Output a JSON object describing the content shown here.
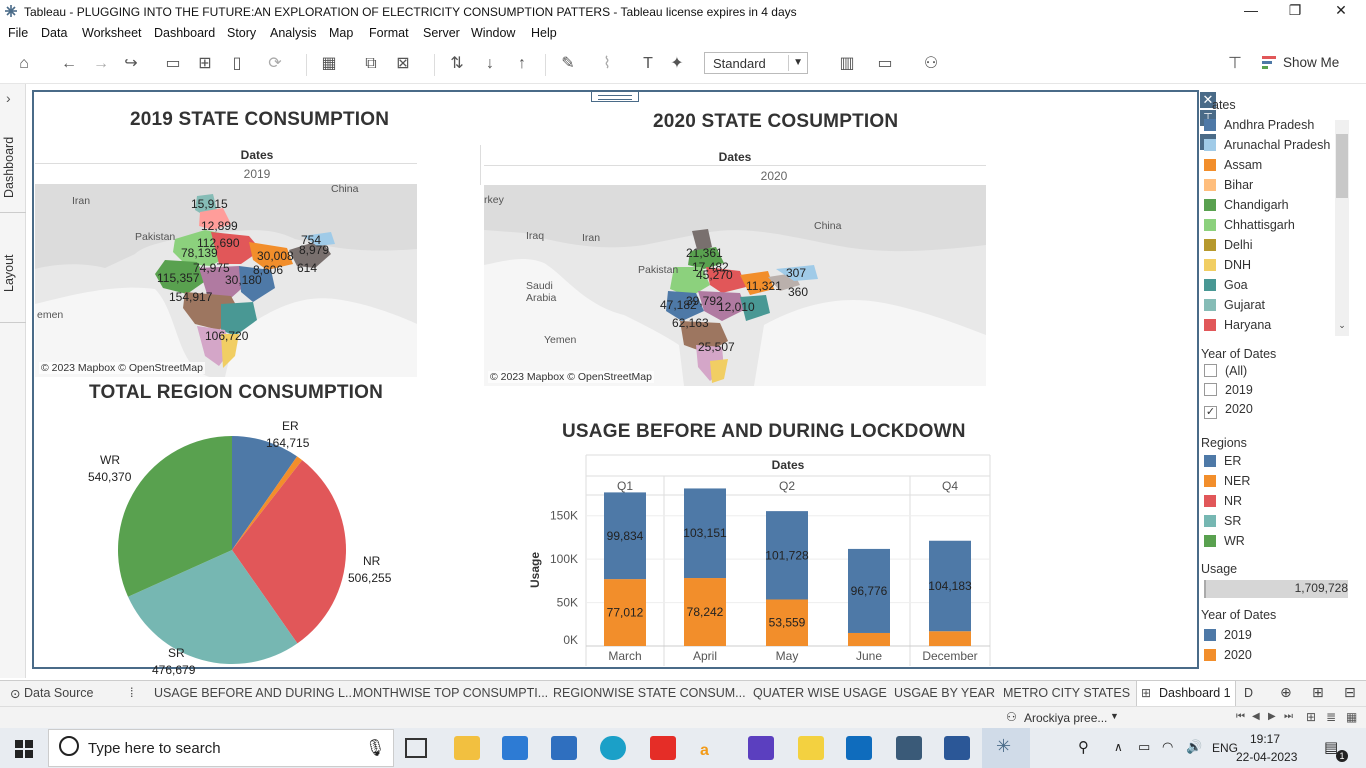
{
  "window": {
    "title": "Tableau - PLUGGING INTO THE FUTURE:AN EXPLORATION OF ELECTRICITY CONSUMPTION PATTERS - Tableau license expires in 4 days",
    "minimize": "—",
    "maximize": "❐",
    "close": "✕"
  },
  "menu": [
    "File",
    "Data",
    "Worksheet",
    "Dashboard",
    "Story",
    "Analysis",
    "Map",
    "Format",
    "Server",
    "Window",
    "Help"
  ],
  "toolbar": {
    "fit_mode": "Standard",
    "show_me": "Show Me"
  },
  "left_rail": {
    "dashboard_tab": "Dashboard",
    "layout_tab": "Layout",
    "expand": "›"
  },
  "map2019": {
    "title": "2019 STATE CONSUMPTION",
    "header": "Dates",
    "year": "2019",
    "credit": "© 2023 Mapbox © OpenStreetMap",
    "place_labels": [
      "Iran",
      "Pakistan",
      "China",
      "emen"
    ],
    "value_labels": [
      "15,915",
      "12,899",
      "112,690",
      "78,139",
      "74,975",
      "30,008",
      "754",
      "8,979",
      "8,606",
      "614",
      "115,357",
      "30,180",
      "154,917",
      "106,720"
    ]
  },
  "map2020": {
    "title": "2020 STATE COSUMPTION",
    "header": "Dates",
    "year": "2020",
    "credit": "© 2023 Mapbox © OpenStreetMap",
    "place_labels": [
      "rkey",
      "Iraq",
      "Iran",
      "Saudi",
      "Arabia",
      "Yemen",
      "Pakistan",
      "China"
    ],
    "value_labels": [
      "21,361",
      "17,482",
      "45,270",
      "11,321",
      "307",
      "360",
      "39,792",
      "47,182",
      "12,010",
      "62,163",
      "25,507"
    ]
  },
  "pie": {
    "title": "TOTAL REGION CONSUMPTION",
    "slices": [
      {
        "region": "ER",
        "value": "164,715",
        "color": "#4e79a7"
      },
      {
        "region": "NER",
        "value": "",
        "color": "#f28e2b"
      },
      {
        "region": "NR",
        "value": "506,255",
        "color": "#e15759"
      },
      {
        "region": "SR",
        "value": "476,679",
        "color": "#76b7b2"
      },
      {
        "region": "WR",
        "value": "540,370",
        "color": "#59a14f"
      }
    ]
  },
  "chart_data": {
    "type": "bar",
    "title": "USAGE BEFORE AND DURING LOCKDOWN",
    "column_header": "Dates",
    "quarters": [
      {
        "label": "Q1",
        "months": [
          "March"
        ]
      },
      {
        "label": "Q2",
        "months": [
          "April",
          "May",
          "June"
        ]
      },
      {
        "label": "Q4",
        "months": [
          "December"
        ]
      }
    ],
    "categories": [
      "March",
      "April",
      "May",
      "June",
      "December"
    ],
    "ylabel": "Usage",
    "yticks": [
      "0K",
      "50K",
      "100K",
      "150K"
    ],
    "ylim": [
      0,
      175000
    ],
    "stacked": true,
    "series": [
      {
        "name": "2020",
        "values": [
          77012,
          78242,
          53559,
          15000,
          17000
        ],
        "labels": [
          "77,012",
          "78,242",
          "53,559",
          "",
          ""
        ],
        "color": "#f28e2b"
      },
      {
        "name": "2019",
        "values": [
          99834,
          103151,
          101728,
          96776,
          104183
        ],
        "labels": [
          "99,834",
          "103,151",
          "101,728",
          "96,776",
          "104,183"
        ],
        "color": "#4e79a7"
      }
    ]
  },
  "right_panel": {
    "states_title": "ates",
    "states": [
      {
        "name": "Andhra Pradesh",
        "color": "#4e79a7"
      },
      {
        "name": "Arunachal Pradesh",
        "color": "#a0cbe8"
      },
      {
        "name": "Assam",
        "color": "#f28e2b"
      },
      {
        "name": "Bihar",
        "color": "#ffbe7d"
      },
      {
        "name": "Chandigarh",
        "color": "#59a14f"
      },
      {
        "name": "Chhattisgarh",
        "color": "#8cd17d"
      },
      {
        "name": "Delhi",
        "color": "#b6992d"
      },
      {
        "name": "DNH",
        "color": "#f1ce63"
      },
      {
        "name": "Goa",
        "color": "#499894"
      },
      {
        "name": "Gujarat",
        "color": "#86bcb6"
      },
      {
        "name": "Haryana",
        "color": "#e15759"
      }
    ],
    "year_filter_title": "Year of Dates",
    "year_filter": [
      {
        "label": "(All)",
        "checked": false
      },
      {
        "label": "2019",
        "checked": false
      },
      {
        "label": "2020",
        "checked": true
      }
    ],
    "regions_title": "Regions",
    "regions": [
      {
        "name": "ER",
        "color": "#4e79a7"
      },
      {
        "name": "NER",
        "color": "#f28e2b"
      },
      {
        "name": "NR",
        "color": "#e15759"
      },
      {
        "name": "SR",
        "color": "#76b7b2"
      },
      {
        "name": "WR",
        "color": "#59a14f"
      }
    ],
    "usage_title": "Usage",
    "usage_value": "1,709,728",
    "year_legend_title": "Year of Dates",
    "year_legend": [
      {
        "name": "2019",
        "color": "#4e79a7"
      },
      {
        "name": "2020",
        "color": "#f28e2b"
      }
    ]
  },
  "sheet_tabs": [
    "Data Source",
    "USAGE BEFORE AND DURING L...",
    "MONTHWISE TOP CONSUMPTI...",
    "REGIONWISE STATE CONSUM...",
    "QUATER WISE USAGE",
    "USGAE BY YEAR",
    "METRO CITY STATES",
    "Dashboard 1",
    "D"
  ],
  "status": {
    "user": "Arockiya pree..."
  },
  "taskbar": {
    "search_placeholder": "Type here to search",
    "language": "ENG",
    "time": "19:17",
    "date": "22-04-2023",
    "notifications": "1"
  }
}
